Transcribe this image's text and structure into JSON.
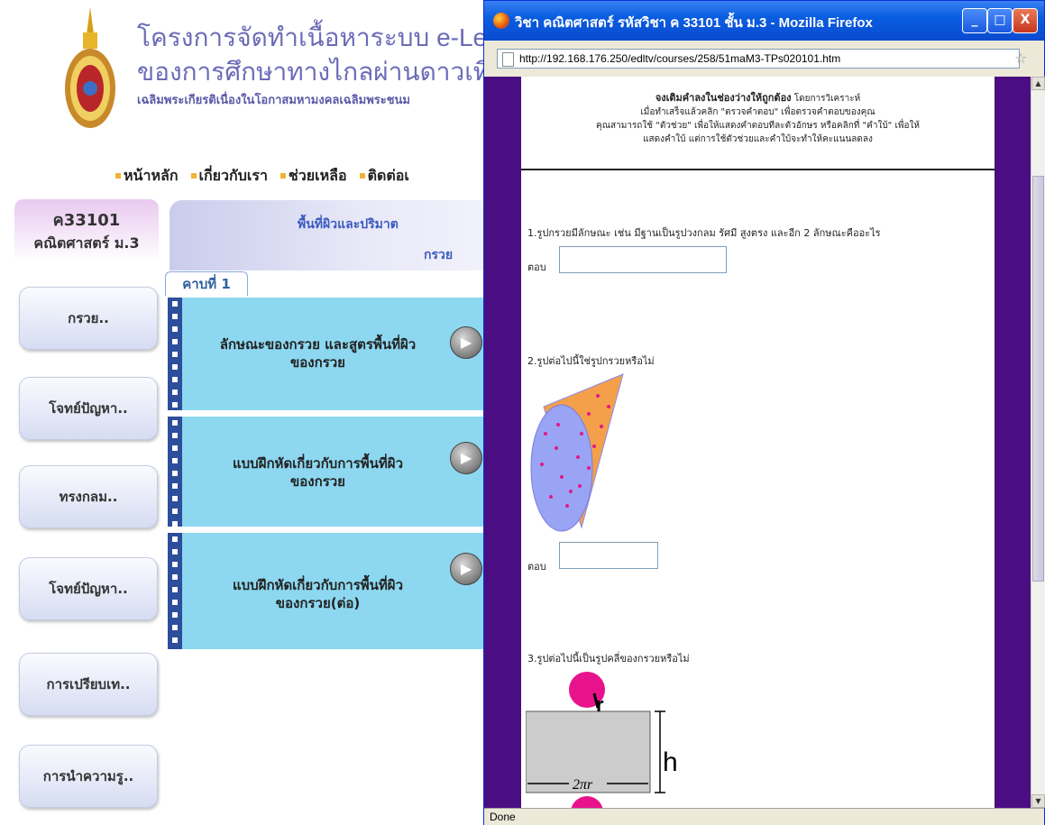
{
  "site": {
    "title_line1": "โครงการจัดทำเนื้อหาระบบ e-Lea",
    "title_line2": "ของการศึกษาทางไกลผ่านดาวเทีย",
    "title_line3": "เฉลิมพระเกียรติเนื่องในโอกาสมหามงคลเฉลิมพระชนม",
    "nav": [
      "หน้าหลัก",
      "เกี่ยวกับเรา",
      "ช่วยเหลือ",
      "ติดต่อเ"
    ]
  },
  "course": {
    "code": "ค33101",
    "name": "คณิตศาสตร์ ม.3"
  },
  "lesson": {
    "title": "พื้นที่ผิวและปริมาต",
    "subtitle": "กรวย",
    "period_tab": "คาบที่ 1"
  },
  "sidebar": [
    "กรวย..",
    "โจทย์ปัญหา..",
    "ทรงกลม..",
    "โจทย์ปัญหา..",
    "การเปรียบเท..",
    "การนำความรู.."
  ],
  "lesson_cards": [
    {
      "line1": "ลักษณะของกรวย และสูตรพื้นที่ผิว",
      "line2": "ของกรวย"
    },
    {
      "line1": "แบบฝึกหัดเกี่ยวกับการพื้นที่ผิว",
      "line2": "ของกรวย"
    },
    {
      "line1": "แบบฝึกหัดเกี่ยวกับการพื้นที่ผิว",
      "line2": "ของกรวย(ต่อ)"
    }
  ],
  "firefox": {
    "title": "วิชา คณิตศาสตร์ รหัสวิชา ค 33101 ชั้น ม.3 - Mozilla Firefox",
    "url": "http://192.168.176.250/edltv/courses/258/51maM3-TPs020101.htm",
    "status": "Done",
    "min_label": "_",
    "max_label": "□",
    "close_label": "X"
  },
  "worksheet": {
    "instr_bold": "จงเติมคำลงในช่องว่างให้ถูกต้อง",
    "instr_rest": "โดยการวิเคราะห์",
    "instr_line2": "เมื่อทำเสร็จแล้วคลิก \"ตรวจคำตอบ\" เพื่อตรวจคำตอบของคุณ",
    "instr_line3": "คุณสามารถใช้ \"ตัวช่วย\" เพื่อให้แสดงคำตอบทีละตัวอักษร หรือคลิกที่ \"คำใบ้\" เพื่อให้",
    "instr_line4": "แสดงคำใบ้ แต่การใช้ตัวช่วยและคำใบ้จะทำให้คะแนนลดลง",
    "q1": "1.รูปกรวยมีลักษณะ เช่น มีฐานเป็นรูปวงกลม รัศมี สูงตรง และอีก 2 ลักษณะคืออะไร",
    "q2": "2.รูปต่อไปนี้ใช่รูปกรวยหรือไม่",
    "q3": "3.รูปต่อไปนี้เป็นรูปคลี่ของกรวยหรือไม่",
    "answer_label": "ตอบ",
    "fig_r": "r",
    "fig_h": "h",
    "fig_2pr": "2πr"
  }
}
